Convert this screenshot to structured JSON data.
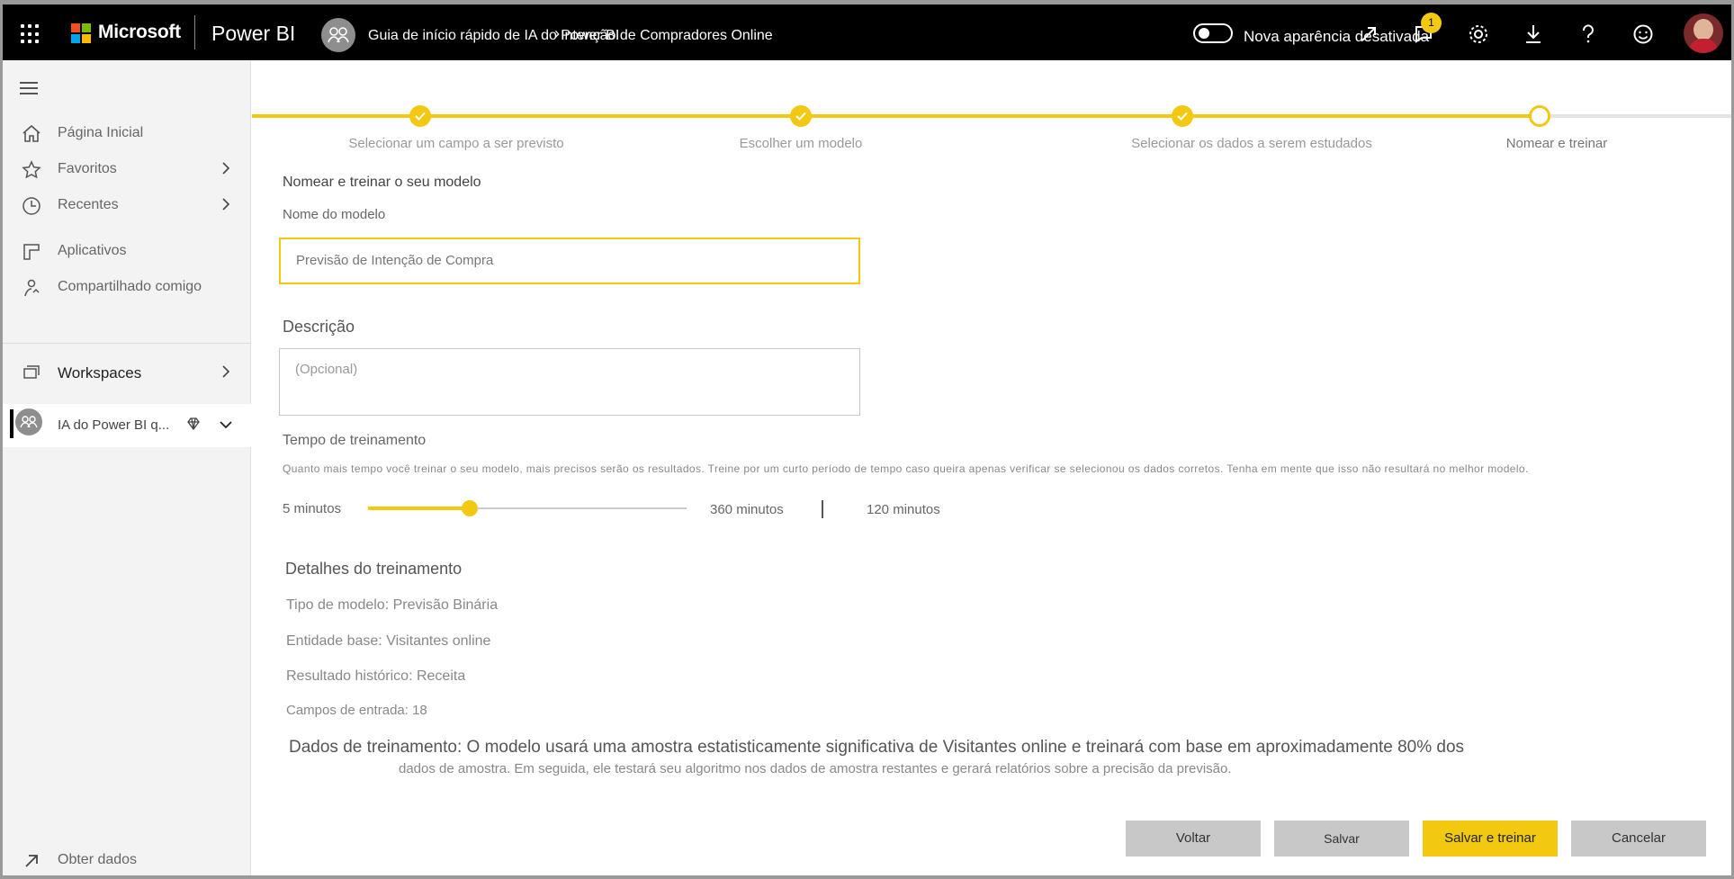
{
  "topbar": {
    "brand": "Microsoft",
    "product": "Power BI",
    "breadcrumb_workspace": "Guia de início rápido de IA do Power BI",
    "breadcrumb_item": "Intenção de Compradores Online",
    "toggle_label": "Nova aparência desativada",
    "notification_count": "1"
  },
  "sidebar": {
    "items": [
      {
        "label": "Página Inicial",
        "icon": "home-icon"
      },
      {
        "label": "Favoritos",
        "icon": "star-icon"
      },
      {
        "label": "Recentes",
        "icon": "clock-icon"
      },
      {
        "label": "Aplicativos",
        "icon": "apps-icon"
      },
      {
        "label": "Compartilhado comigo",
        "icon": "shared-icon"
      }
    ],
    "workspaces_label": "Workspaces",
    "current_workspace": "IA do Power BI q...",
    "get_data": "Obter dados"
  },
  "steps": [
    {
      "label": "Selecionar um campo a ser previsto",
      "state": "done"
    },
    {
      "label": "Escolher um modelo",
      "state": "done"
    },
    {
      "label": "Selecionar os dados a serem estudados",
      "state": "done"
    },
    {
      "label": "Nomear e treinar",
      "state": "current"
    }
  ],
  "form": {
    "section_title": "Nomear e treinar o seu modelo",
    "model_name_label": "Nome do modelo",
    "model_name_value": "Previsão de Intenção de Compra",
    "description_label": "Descrição",
    "description_placeholder": "(Opcional)",
    "training_time_label": "Tempo de treinamento",
    "training_time_note": "Quanto mais tempo você treinar o seu modelo, mais precisos serão os resultados. Treine por um curto período de tempo caso queira apenas verificar se selecionou os dados corretos. Tenha em mente que isso não resultará no melhor modelo.",
    "slider_min": "5 minutos",
    "slider_max": "360 minutos",
    "slider_value": "120 minutos",
    "slider_fraction": 0.32
  },
  "details": {
    "title": "Detalhes do treinamento",
    "model_type": "Tipo de modelo: Previsão Binária",
    "base_entity": "Entidade base: Visitantes online",
    "historical_result": "Resultado histórico: Receita",
    "input_fields": "Campos de entrada: 18",
    "training_data_line1": "Dados de treinamento: O modelo usará uma amostra estatisticamente significativa de Visitantes online e treinará com base em aproximadamente 80% dos",
    "training_data_line2": "dados de amostra. Em seguida, ele testará seu algoritmo nos dados de amostra restantes e gerará relatórios sobre a precisão da previsão."
  },
  "buttons": {
    "back": "Voltar",
    "save": "Salvar",
    "save_train": "Salvar e treinar",
    "cancel": "Cancelar"
  },
  "colors": {
    "accent": "#f2c811",
    "topbar": "#000000"
  }
}
